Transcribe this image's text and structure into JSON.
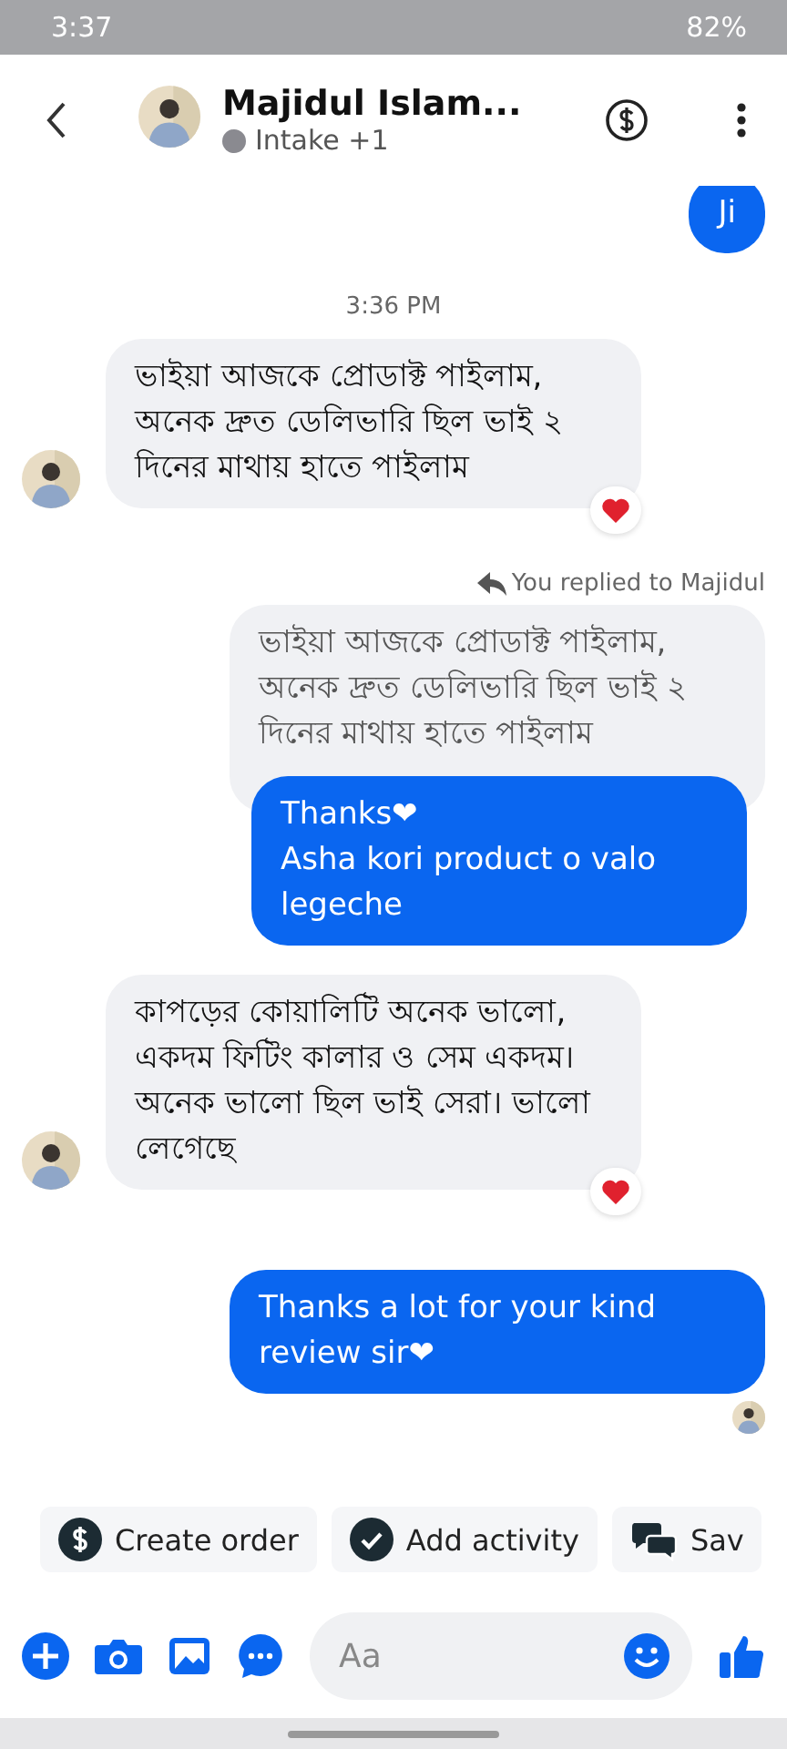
{
  "status_bar": {
    "time": "3:37",
    "battery": "82%"
  },
  "header": {
    "name": "Majidul Islam...",
    "label": "Intake +1"
  },
  "messages": [
    {
      "kind": "outgoing",
      "text": "Ji",
      "seen": false
    },
    {
      "kind": "timestamp",
      "text": "3:36 PM"
    },
    {
      "kind": "incoming",
      "text": "ভাইয়া আজকে প্রোডাক্ট পাইলাম, অনেক দ্রুত ডেলিভারি ছিল ভাই ২ দিনের মাথায় হাতে পাইলাম",
      "reaction": true
    },
    {
      "kind": "reply",
      "note": "You replied to Majidul",
      "quoted": "ভাইয়া আজকে প্রোডাক্ট পাইলাম, অনেক দ্রুত ডেলিভারি ছিল ভাই ২ দিনের মাথায় হাতে পাইলাম",
      "text": "Thanks❤\nAsha kori product o valo legeche"
    },
    {
      "kind": "incoming",
      "text": "কাপড়ের কোয়ালিটি অনেক ভালো, একদম ফিটিং কালার ও সেম একদম। অনেক ভালো ছিল ভাই সেরা। ভালো লেগেছে",
      "reaction": true
    },
    {
      "kind": "outgoing",
      "text": "Thanks a lot for your kind review sir❤",
      "seen": true
    }
  ],
  "actions": [
    {
      "kind": "order",
      "label": "Create order"
    },
    {
      "kind": "activity",
      "label": "Add activity"
    },
    {
      "kind": "saved",
      "label": "Sav"
    }
  ],
  "composer": {
    "placeholder": "Aa"
  }
}
